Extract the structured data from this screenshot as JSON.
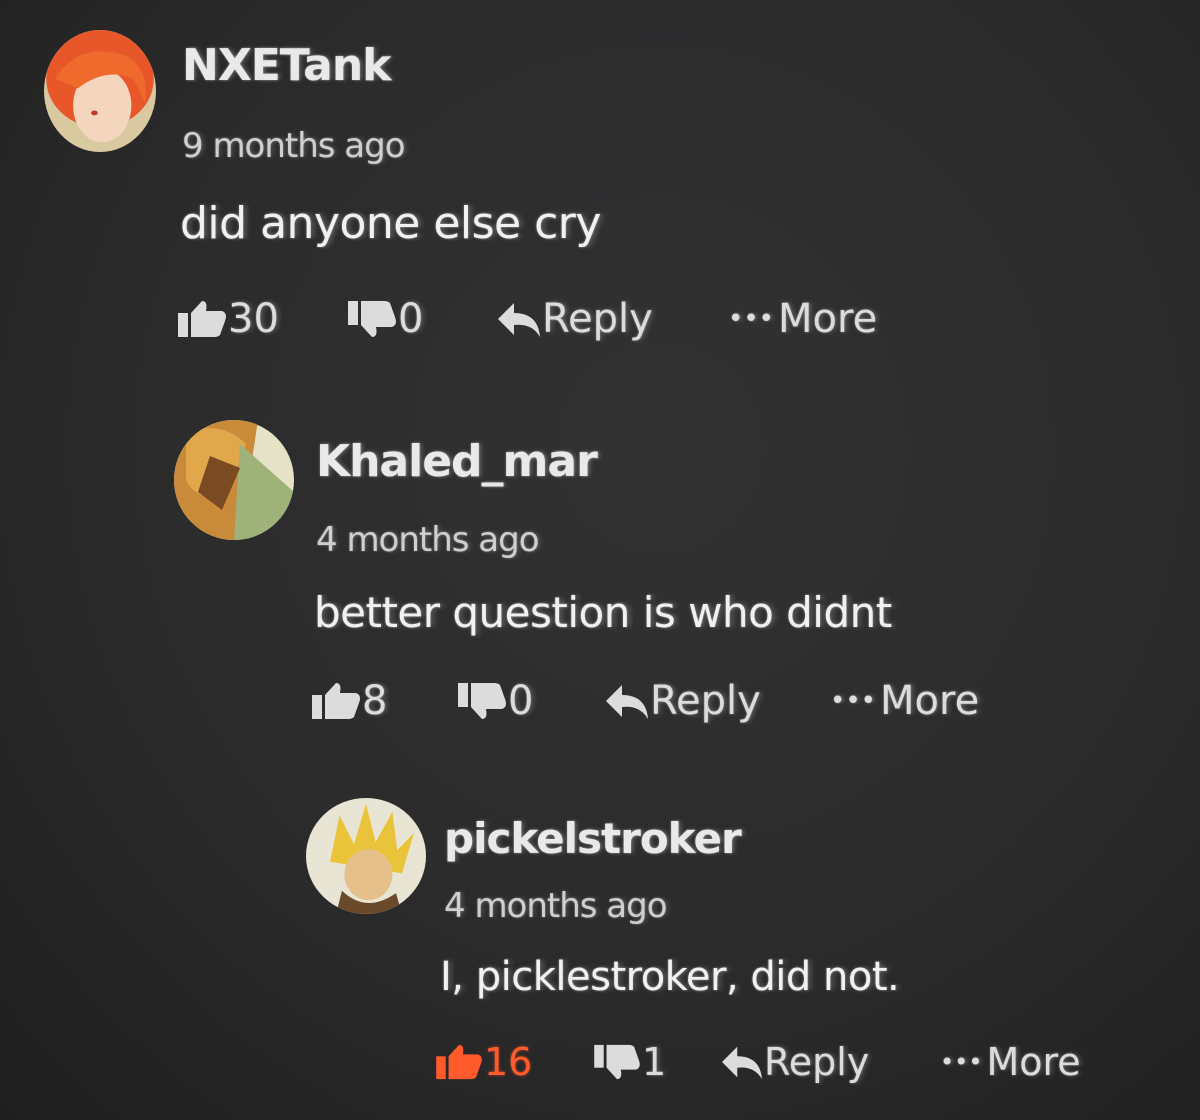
{
  "colors": {
    "background": "#2b2b2c",
    "text": "#e9e9e9",
    "muted": "#cfcfcf",
    "accent_liked": "#ff5a2c"
  },
  "comments": [
    {
      "username": "NXETank",
      "timestamp": "9 months ago",
      "body": "did anyone else cry",
      "likes": "30",
      "dislikes": "0",
      "reply_label": "Reply",
      "more_label": "More",
      "liked": false
    },
    {
      "username": "Khaled_mar",
      "timestamp": "4 months ago",
      "body": "better question is who didnt",
      "likes": "8",
      "dislikes": "0",
      "reply_label": "Reply",
      "more_label": "More",
      "liked": false
    },
    {
      "username": "pickelstroker",
      "timestamp": "4 months ago",
      "body": "I, picklestroker, did not.",
      "likes": "16",
      "dislikes": "1",
      "reply_label": "Reply",
      "more_label": "More",
      "liked": true
    }
  ],
  "icons": {
    "like": "thumbs-up-icon",
    "dislike": "thumbs-down-icon",
    "reply": "reply-arrow-icon",
    "more": "ellipsis-icon"
  }
}
